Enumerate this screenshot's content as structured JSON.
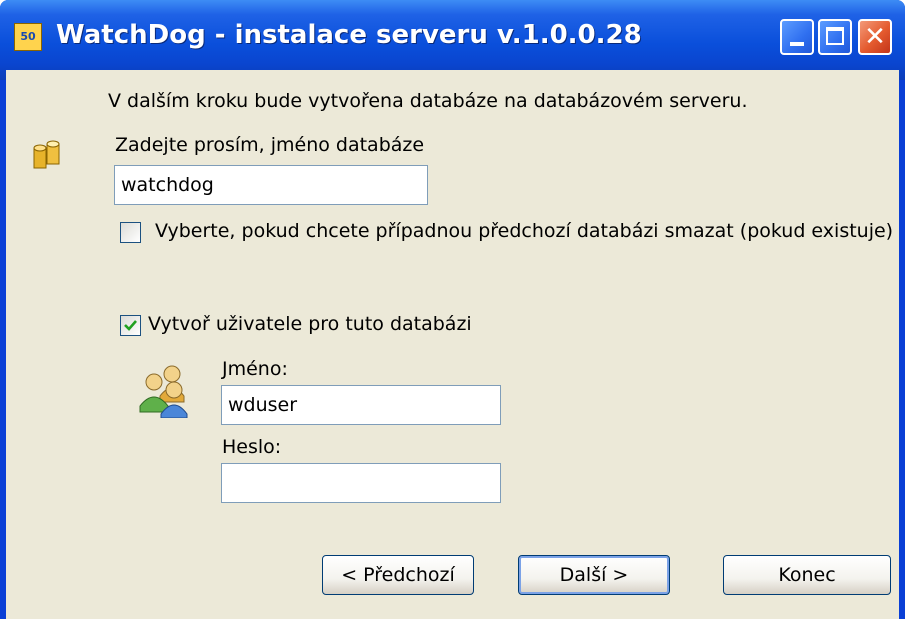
{
  "window": {
    "title": "WatchDog - instalace serveru v.1.0.0.28",
    "app_icon_text": "50",
    "controls": {
      "minimize": "minimize",
      "maximize": "maximize",
      "close": "close"
    }
  },
  "intro_text": "V dalším kroku bude vytvořena databáze na databázovém serveru.",
  "database": {
    "label": "Zadejte prosím, jméno databáze",
    "value": "watchdog",
    "icon": "database-icon"
  },
  "delete_checkbox": {
    "label": "Vyberte, pokud chcete případnou předchozí databázi smazat (pokud existuje)",
    "checked": false
  },
  "create_user_checkbox": {
    "label": "Vytvoř uživatele pro tuto databázi",
    "checked": true
  },
  "user": {
    "icon": "users-icon",
    "name_label": "Jméno:",
    "name_value": "wduser",
    "password_label": "Heslo:",
    "password_value": ""
  },
  "buttons": {
    "back": "< Předchozí",
    "next": "Další >",
    "exit": "Konec"
  },
  "colors": {
    "titlebar": "#0a4fdb",
    "client_bg": "#ece9d8",
    "check_mark": "#21a121"
  }
}
